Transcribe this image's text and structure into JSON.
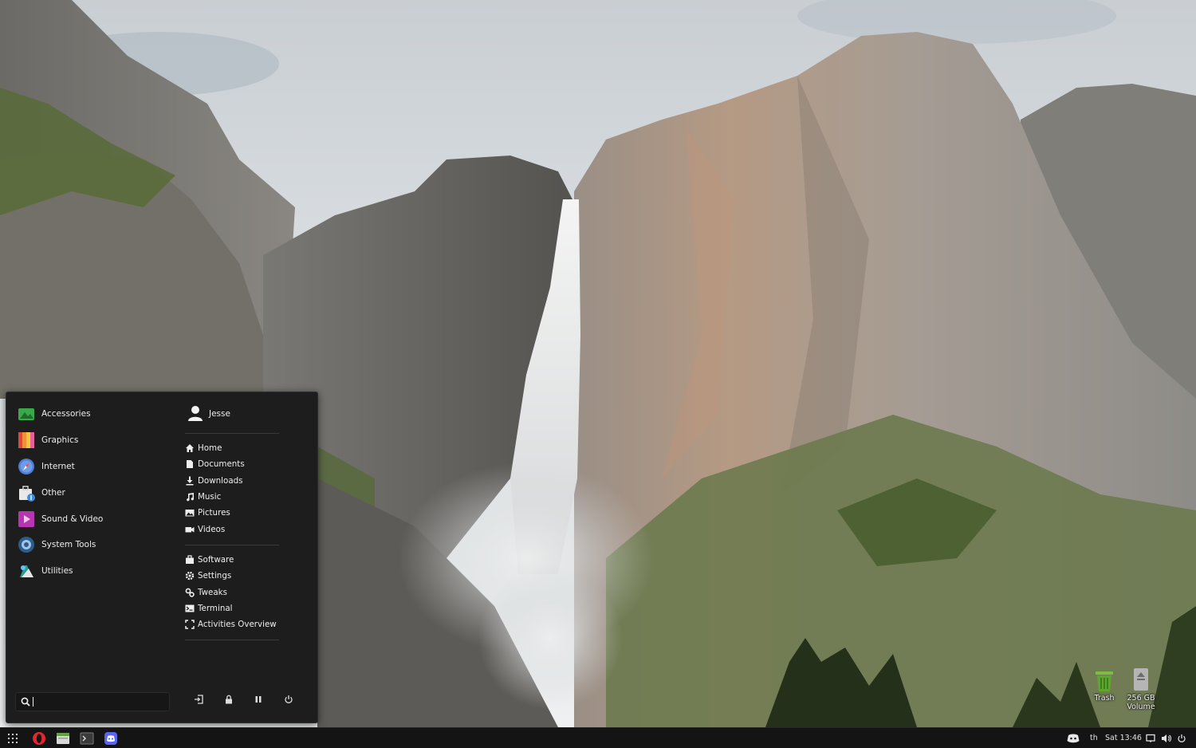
{
  "desktop": {
    "icons": [
      {
        "name": "Trash",
        "icon": "trash-icon"
      },
      {
        "name": "256 GB Volume",
        "icon": "drive-icon"
      }
    ]
  },
  "app_menu": {
    "categories": [
      {
        "label": "Accessories",
        "icon": "accessories-icon"
      },
      {
        "label": "Graphics",
        "icon": "graphics-icon"
      },
      {
        "label": "Internet",
        "icon": "internet-icon"
      },
      {
        "label": "Other",
        "icon": "other-icon"
      },
      {
        "label": "Sound & Video",
        "icon": "sound-video-icon"
      },
      {
        "label": "System Tools",
        "icon": "system-tools-icon"
      },
      {
        "label": "Utilities",
        "icon": "utilities-icon"
      }
    ],
    "user": {
      "name": "Jesse",
      "icon": "user-icon"
    },
    "places": [
      {
        "label": "Home",
        "icon": "home-icon"
      },
      {
        "label": "Documents",
        "icon": "document-icon"
      },
      {
        "label": "Downloads",
        "icon": "download-icon"
      },
      {
        "label": "Music",
        "icon": "music-icon"
      },
      {
        "label": "Pictures",
        "icon": "pictures-icon"
      },
      {
        "label": "Videos",
        "icon": "video-icon"
      }
    ],
    "system": [
      {
        "label": "Software",
        "icon": "software-icon"
      },
      {
        "label": "Settings",
        "icon": "gear-icon"
      },
      {
        "label": "Tweaks",
        "icon": "tweaks-icon"
      },
      {
        "label": "Terminal",
        "icon": "terminal-icon"
      },
      {
        "label": "Activities Overview",
        "icon": "overview-icon"
      }
    ],
    "search": {
      "value": ""
    },
    "session_buttons": [
      "logout-icon",
      "lock-icon",
      "suspend-icon",
      "power-icon"
    ]
  },
  "taskbar": {
    "launchers": [
      "opera-icon",
      "files-icon",
      "terminal-icon",
      "discord-icon"
    ],
    "keyboard_layout": "th",
    "clock": "Sat 13:46"
  }
}
